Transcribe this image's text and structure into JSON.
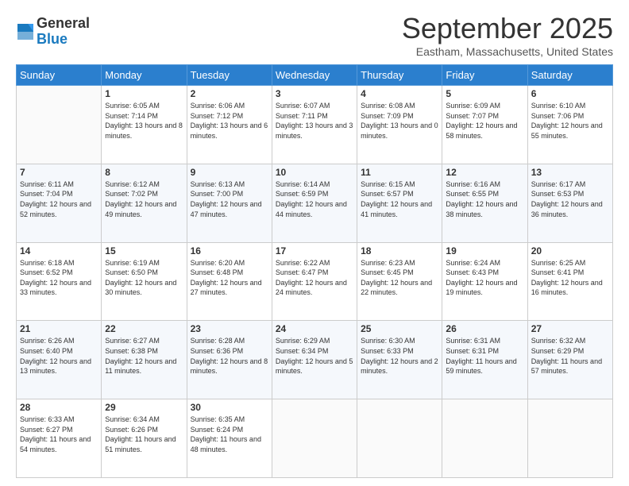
{
  "logo": {
    "line1": "General",
    "line2": "Blue"
  },
  "title": "September 2025",
  "location": "Eastham, Massachusetts, United States",
  "weekdays": [
    "Sunday",
    "Monday",
    "Tuesday",
    "Wednesday",
    "Thursday",
    "Friday",
    "Saturday"
  ],
  "weeks": [
    [
      {
        "day": "",
        "sunrise": "",
        "sunset": "",
        "daylight": ""
      },
      {
        "day": "1",
        "sunrise": "6:05 AM",
        "sunset": "7:14 PM",
        "daylight": "13 hours and 8 minutes."
      },
      {
        "day": "2",
        "sunrise": "6:06 AM",
        "sunset": "7:12 PM",
        "daylight": "13 hours and 6 minutes."
      },
      {
        "day": "3",
        "sunrise": "6:07 AM",
        "sunset": "7:11 PM",
        "daylight": "13 hours and 3 minutes."
      },
      {
        "day": "4",
        "sunrise": "6:08 AM",
        "sunset": "7:09 PM",
        "daylight": "13 hours and 0 minutes."
      },
      {
        "day": "5",
        "sunrise": "6:09 AM",
        "sunset": "7:07 PM",
        "daylight": "12 hours and 58 minutes."
      },
      {
        "day": "6",
        "sunrise": "6:10 AM",
        "sunset": "7:06 PM",
        "daylight": "12 hours and 55 minutes."
      }
    ],
    [
      {
        "day": "7",
        "sunrise": "6:11 AM",
        "sunset": "7:04 PM",
        "daylight": "12 hours and 52 minutes."
      },
      {
        "day": "8",
        "sunrise": "6:12 AM",
        "sunset": "7:02 PM",
        "daylight": "12 hours and 49 minutes."
      },
      {
        "day": "9",
        "sunrise": "6:13 AM",
        "sunset": "7:00 PM",
        "daylight": "12 hours and 47 minutes."
      },
      {
        "day": "10",
        "sunrise": "6:14 AM",
        "sunset": "6:59 PM",
        "daylight": "12 hours and 44 minutes."
      },
      {
        "day": "11",
        "sunrise": "6:15 AM",
        "sunset": "6:57 PM",
        "daylight": "12 hours and 41 minutes."
      },
      {
        "day": "12",
        "sunrise": "6:16 AM",
        "sunset": "6:55 PM",
        "daylight": "12 hours and 38 minutes."
      },
      {
        "day": "13",
        "sunrise": "6:17 AM",
        "sunset": "6:53 PM",
        "daylight": "12 hours and 36 minutes."
      }
    ],
    [
      {
        "day": "14",
        "sunrise": "6:18 AM",
        "sunset": "6:52 PM",
        "daylight": "12 hours and 33 minutes."
      },
      {
        "day": "15",
        "sunrise": "6:19 AM",
        "sunset": "6:50 PM",
        "daylight": "12 hours and 30 minutes."
      },
      {
        "day": "16",
        "sunrise": "6:20 AM",
        "sunset": "6:48 PM",
        "daylight": "12 hours and 27 minutes."
      },
      {
        "day": "17",
        "sunrise": "6:22 AM",
        "sunset": "6:47 PM",
        "daylight": "12 hours and 24 minutes."
      },
      {
        "day": "18",
        "sunrise": "6:23 AM",
        "sunset": "6:45 PM",
        "daylight": "12 hours and 22 minutes."
      },
      {
        "day": "19",
        "sunrise": "6:24 AM",
        "sunset": "6:43 PM",
        "daylight": "12 hours and 19 minutes."
      },
      {
        "day": "20",
        "sunrise": "6:25 AM",
        "sunset": "6:41 PM",
        "daylight": "12 hours and 16 minutes."
      }
    ],
    [
      {
        "day": "21",
        "sunrise": "6:26 AM",
        "sunset": "6:40 PM",
        "daylight": "12 hours and 13 minutes."
      },
      {
        "day": "22",
        "sunrise": "6:27 AM",
        "sunset": "6:38 PM",
        "daylight": "12 hours and 11 minutes."
      },
      {
        "day": "23",
        "sunrise": "6:28 AM",
        "sunset": "6:36 PM",
        "daylight": "12 hours and 8 minutes."
      },
      {
        "day": "24",
        "sunrise": "6:29 AM",
        "sunset": "6:34 PM",
        "daylight": "12 hours and 5 minutes."
      },
      {
        "day": "25",
        "sunrise": "6:30 AM",
        "sunset": "6:33 PM",
        "daylight": "12 hours and 2 minutes."
      },
      {
        "day": "26",
        "sunrise": "6:31 AM",
        "sunset": "6:31 PM",
        "daylight": "11 hours and 59 minutes."
      },
      {
        "day": "27",
        "sunrise": "6:32 AM",
        "sunset": "6:29 PM",
        "daylight": "11 hours and 57 minutes."
      }
    ],
    [
      {
        "day": "28",
        "sunrise": "6:33 AM",
        "sunset": "6:27 PM",
        "daylight": "11 hours and 54 minutes."
      },
      {
        "day": "29",
        "sunrise": "6:34 AM",
        "sunset": "6:26 PM",
        "daylight": "11 hours and 51 minutes."
      },
      {
        "day": "30",
        "sunrise": "6:35 AM",
        "sunset": "6:24 PM",
        "daylight": "11 hours and 48 minutes."
      },
      {
        "day": "",
        "sunrise": "",
        "sunset": "",
        "daylight": ""
      },
      {
        "day": "",
        "sunrise": "",
        "sunset": "",
        "daylight": ""
      },
      {
        "day": "",
        "sunrise": "",
        "sunset": "",
        "daylight": ""
      },
      {
        "day": "",
        "sunrise": "",
        "sunset": "",
        "daylight": ""
      }
    ]
  ],
  "labels": {
    "sunrise": "Sunrise:",
    "sunset": "Sunset:",
    "daylight": "Daylight:"
  }
}
